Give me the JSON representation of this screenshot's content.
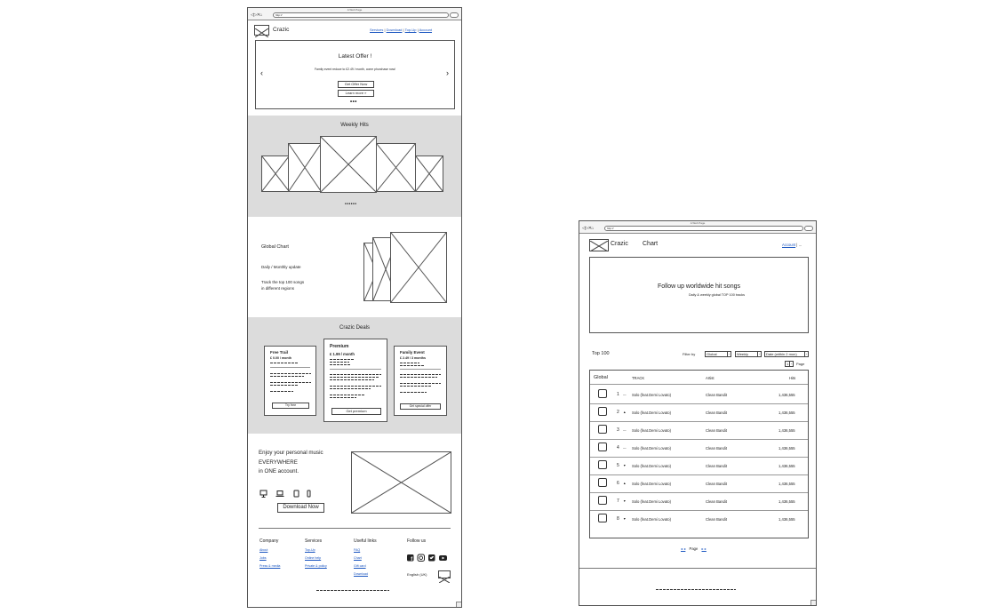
{
  "left_page": {
    "window_title": "A Web Page",
    "url": "http://",
    "brand": "Crazic",
    "nav": [
      "Services",
      "Download",
      "Top-Up",
      "Account"
    ],
    "offer": {
      "title": "Latest Offer !",
      "text": "Family event reduce to £2.49 / month, come phurchase now!",
      "primary_button": "Get Offer Now",
      "secondary_button": "Learn more »",
      "prev": "‹",
      "next": "›",
      "dots": "•••"
    },
    "weekly": {
      "title": "Weekly Hits",
      "dots": "••••••"
    },
    "global_chart": {
      "title": "Global Chart",
      "line1": "Daily / Monthly update",
      "line2a": "Track the top 100 songs",
      "line2b": "in different regions"
    },
    "deals": {
      "title": "Crazic Deals",
      "cards": [
        {
          "name": "Free Trail",
          "price": "£ 0.00 / month",
          "button": "Try free"
        },
        {
          "name": "Premium",
          "price": "£ 1.99 / month",
          "button": "Get premium"
        },
        {
          "name": "Family Event",
          "price": "£ 2.49 / 3 months",
          "button": "Get special offer"
        }
      ]
    },
    "download": {
      "line1": "Enjoy your personal music",
      "line2": "EVERYWHERE",
      "line3": "in ONE account.",
      "button": "Download Now"
    },
    "footer": {
      "company": {
        "title": "Company",
        "links": [
          "About",
          "Jobs",
          "Press & media"
        ]
      },
      "services": {
        "title": "Services",
        "links": [
          "Top-Up",
          "Online help",
          "Private & policy"
        ]
      },
      "useful": {
        "title": "Useful links",
        "links": [
          "FAQ",
          "Chart",
          "Gift card",
          "Download"
        ]
      },
      "follow": {
        "title": "Follow us"
      },
      "language": "English (UK)"
    }
  },
  "right_page": {
    "window_title": "A Web Page",
    "url": "http://",
    "brand": "Crazic",
    "section_title": "Chart",
    "nav": [
      "Account"
    ],
    "nav_more": "...",
    "hero": {
      "title": "Follow up worldwide hit songs",
      "subtitle": "Daily & weekly global TOP 100 tracks"
    },
    "top_label": "Top 100",
    "filter_label": "Filter by",
    "filters": [
      "Global",
      "Weekly",
      "Date (within 2 mon)"
    ],
    "page_box": "1",
    "page_label": "Page",
    "table": {
      "headers": {
        "region": "Global",
        "track": "TRACK",
        "artist": "Artist",
        "hits": "Hits"
      },
      "rows": [
        {
          "rank": "1",
          "trend": "—",
          "track": "Solo (feat.Demi Lovato)",
          "artist": "Clean Bandit",
          "hits": "1,436,555"
        },
        {
          "rank": "2",
          "trend": "▲",
          "track": "Solo (feat.Demi Lovato)",
          "artist": "Clean Bandit",
          "hits": "1,436,555"
        },
        {
          "rank": "3",
          "trend": "—",
          "track": "Solo (feat.Demi Lovato)",
          "artist": "Clean Bandit",
          "hits": "1,436,555"
        },
        {
          "rank": "4",
          "trend": "—",
          "track": "Solo (feat.Demi Lovato)",
          "artist": "Clean Bandit",
          "hits": "1,436,555"
        },
        {
          "rank": "5",
          "trend": "▼",
          "track": "Solo (feat.Demi Lovato)",
          "artist": "Clean Bandit",
          "hits": "1,436,555"
        },
        {
          "rank": "6",
          "trend": "▲",
          "track": "Solo (feat.Demi Lovato)",
          "artist": "Clean Bandit",
          "hits": "1,436,555"
        },
        {
          "rank": "7",
          "trend": "▼",
          "track": "Solo (feat.Demi Lovato)",
          "artist": "Clean Bandit",
          "hits": "1,436,555"
        },
        {
          "rank": "8",
          "trend": "▼",
          "track": "Solo (feat.Demi Lovato)",
          "artist": "Clean Bandit",
          "hits": "1,436,555"
        }
      ]
    },
    "pager": {
      "prev": "◂ ◂",
      "label": "Page",
      "next": "▸ ▸"
    }
  },
  "colors": {
    "link": "#1a55c0",
    "section_grey": "#dcdcdc",
    "stroke": "#555555"
  },
  "icons": [
    "facebook-icon",
    "instagram-icon",
    "twitter-icon",
    "youtube-icon",
    "desktop-icon",
    "laptop-icon",
    "tablet-icon",
    "phone-icon"
  ]
}
